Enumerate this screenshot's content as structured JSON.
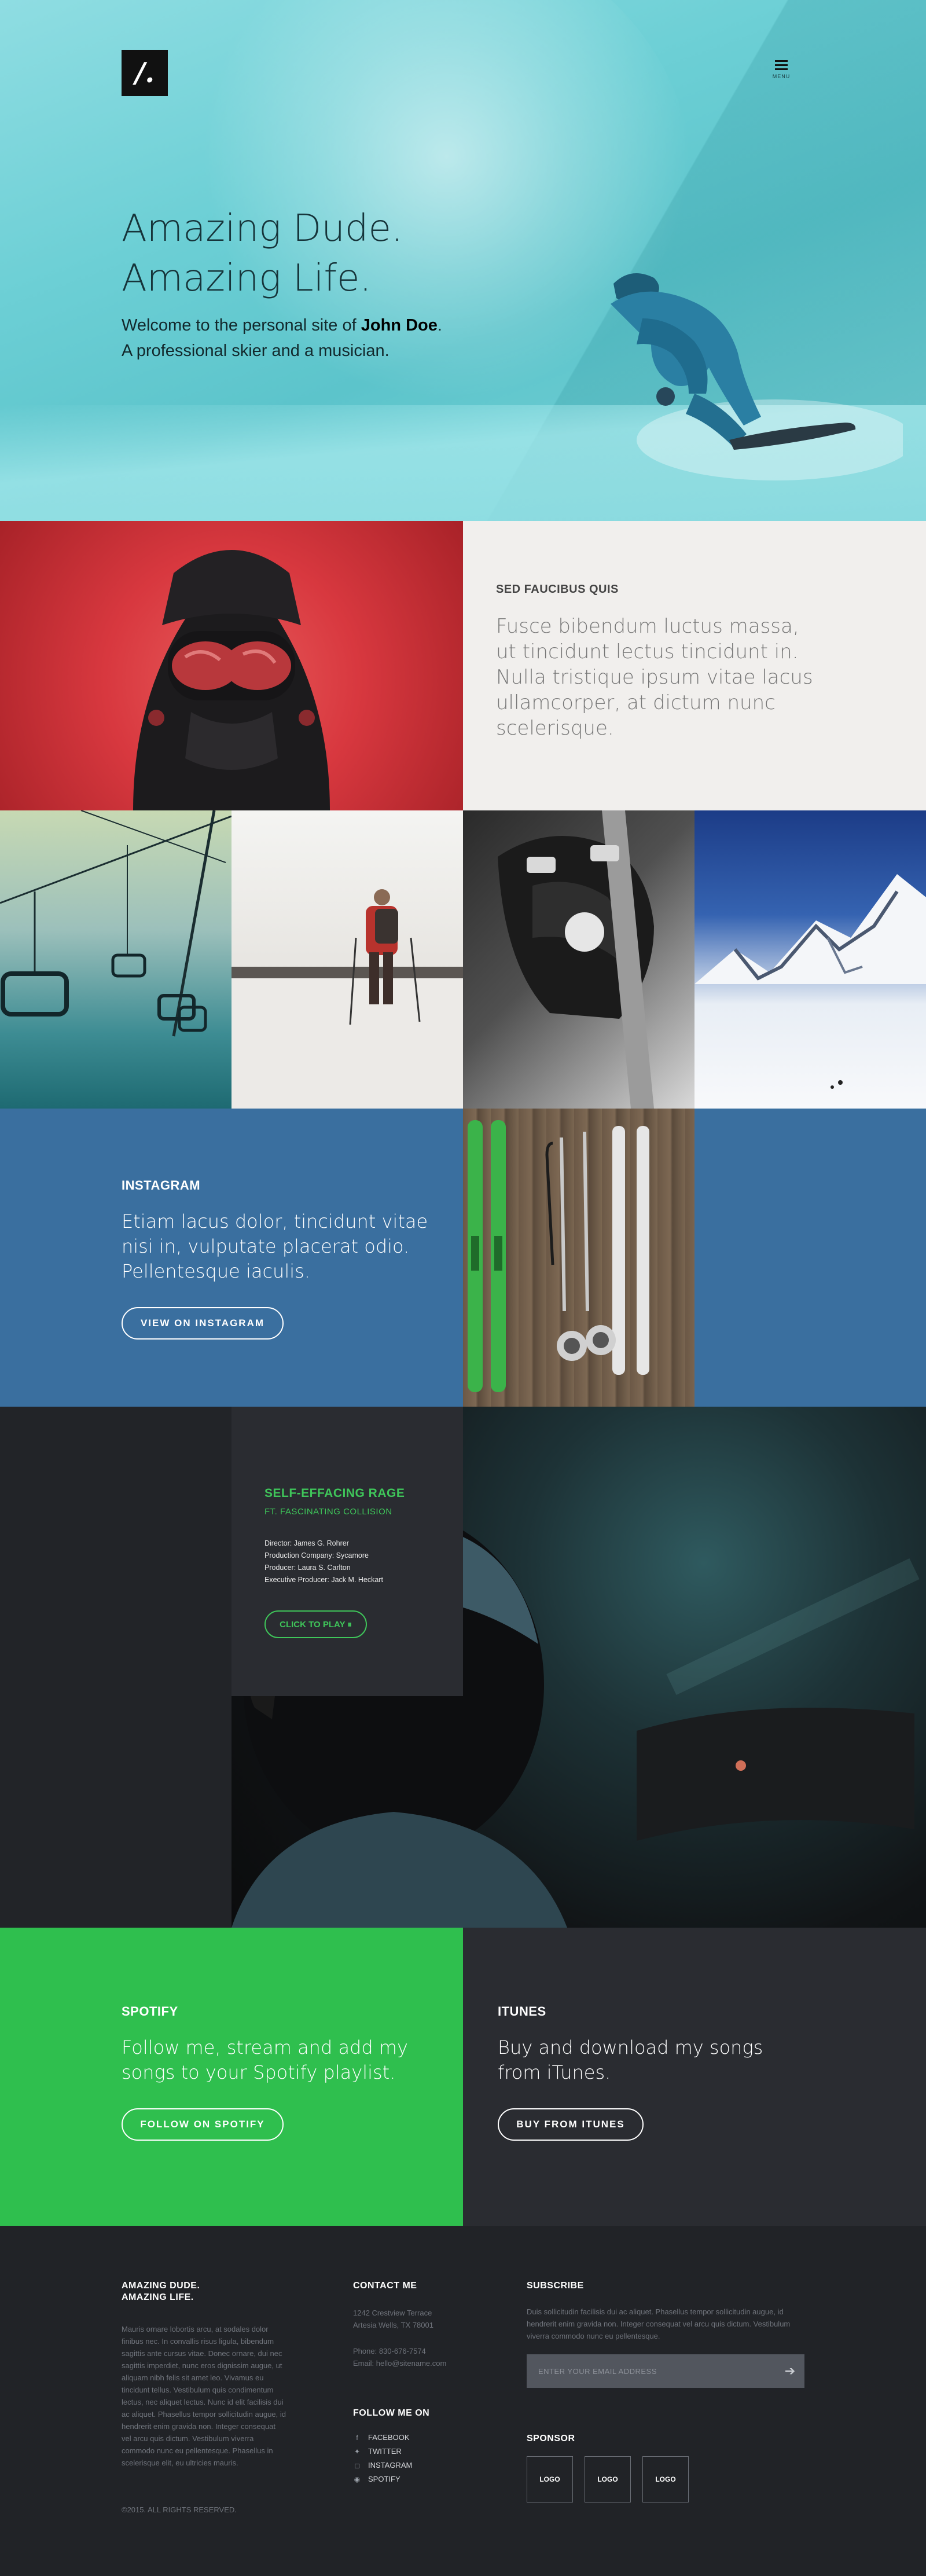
{
  "hero": {
    "logo_text": "/.",
    "menu_label": "MENU",
    "title_line1": "Amazing Dude.",
    "title_line2": "Amazing Life.",
    "subtitle_prefix": "Welcome to the personal site of ",
    "subtitle_name": "John Doe",
    "subtitle_suffix": ".",
    "subtitle_line2": "A professional skier and a musician."
  },
  "feature": {
    "kicker": "SED FAUCIBUS QUIS",
    "body": "Fusce bibendum luctus massa, ut tincidunt lectus tincidunt in. Nulla tristique ipsum vitae lacus ullamcorper, at dictum nunc scelerisque."
  },
  "instagram": {
    "kicker": "INSTAGRAM",
    "body": "Etiam lacus dolor, tincidunt vitae nisi in, vulputate placerat odio. Pellentesque iaculis.",
    "button": "VIEW ON INSTAGRAM"
  },
  "video": {
    "title": "SELF-EFFACING RAGE",
    "subtitle": "FT. FASCINATING COLLISION",
    "credits": [
      "Director: James G. Rohrer",
      "Production Company: Sycamore",
      "Producer: Laura S. Carlton",
      "Executive Producer: Jack M. Heckart"
    ],
    "button": "CLICK TO PLAY ⏸"
  },
  "spotify": {
    "kicker": "SPOTIFY",
    "body": "Follow me, stream and add my songs to your Spotify playlist.",
    "button": "FOLLOW ON SPOTIFY"
  },
  "itunes": {
    "kicker": "ITUNES",
    "body": "Buy and download my songs from iTunes.",
    "button": "BUY FROM ITUNES"
  },
  "footer": {
    "about_title_line1": "AMAZING DUDE.",
    "about_title_line2": "AMAZING LIFE.",
    "about_text": "Mauris ornare lobortis arcu, at sodales dolor finibus nec. In convallis risus ligula, bibendum sagittis ante cursus vitae. Donec ornare, dui nec sagittis imperdiet, nunc eros dignissim augue, ut aliquam nibh felis sit amet leo. Vivamus eu tincidunt tellus. Vestibulum quis condimentum lectus, nec aliquet lectus. Nunc id elit facilisis dui ac aliquet. Phasellus tempor sollicitudin augue, id hendrerit enim gravida non. Integer consequat vel arcu quis dictum. Vestibulum viverra commodo nunc eu pellentesque. Phasellus in scelerisque elit, eu ultricies mauris.",
    "copyright": "©2015. ALL RIGHTS RESERVED.",
    "contact_title": "CONTACT ME",
    "address_line1": "1242 Crestview Terrace",
    "address_line2": "Artesia Wells, TX 78001",
    "phone": "Phone: 830-676-7574",
    "email": "Email: hello@sitename.com",
    "follow_title": "FOLLOW ME ON",
    "social": [
      {
        "icon": "facebook-icon",
        "glyph": "f",
        "label": "FACEBOOK"
      },
      {
        "icon": "twitter-icon",
        "glyph": "🐦",
        "label": "TWITTER"
      },
      {
        "icon": "instagram-icon",
        "glyph": "◻",
        "label": "INSTAGRAM"
      },
      {
        "icon": "spotify-icon",
        "glyph": "◉",
        "label": "SPOTIFY"
      }
    ],
    "subscribe_title": "SUBSCRIBE",
    "subscribe_text": "Duis sollicitudin facilisis dui ac aliquet. Phasellus tempor sollicitudin augue, id hendrerit enim gravida non. Integer consequat vel arcu quis dictum. Vestibulum viverra commodo nunc eu pellentesque.",
    "subscribe_placeholder": "ENTER YOUR EMAIL ADDRESS",
    "sponsor_title": "SPONSOR",
    "sponsors": [
      "LOGO",
      "LOGO",
      "LOGO"
    ]
  },
  "colors": {
    "hero": "#6ccfd5",
    "instagram": "#3a6f9f",
    "spotify": "#2fbf4e",
    "accent_green": "#3fc65a",
    "dark": "#2a2c31",
    "footer": "#212327"
  }
}
